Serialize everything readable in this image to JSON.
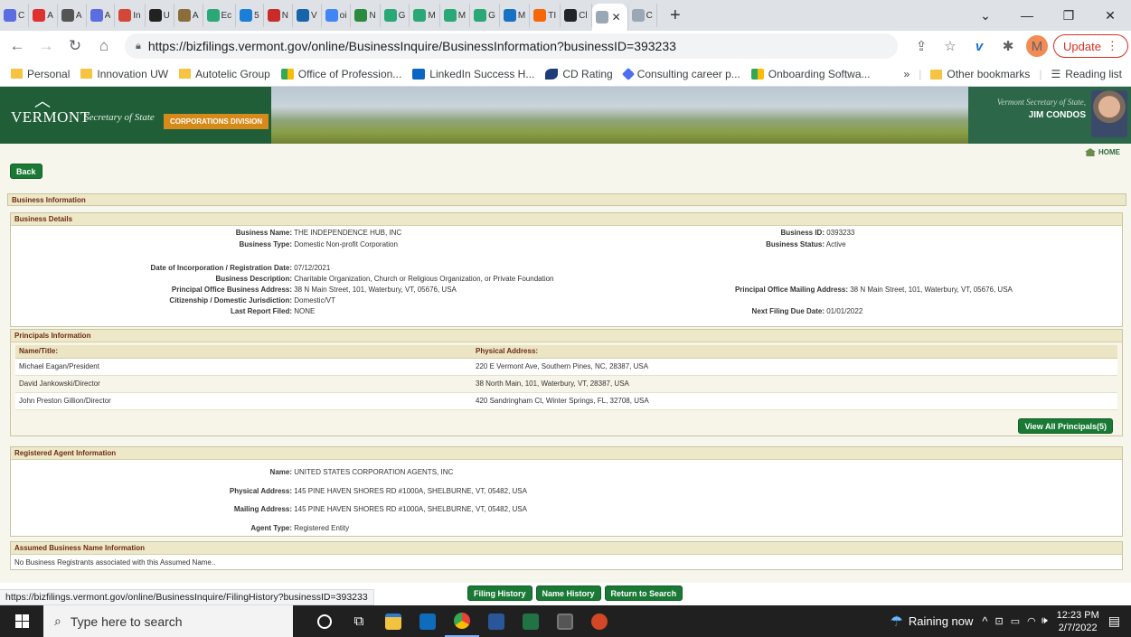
{
  "browser": {
    "tabs": [
      {
        "label": "C",
        "color": "#5b6ee1"
      },
      {
        "label": "A",
        "color": "#e03131"
      },
      {
        "label": "A",
        "color": "#555555"
      },
      {
        "label": "A",
        "color": "#5b6ee1"
      },
      {
        "label": "In",
        "color": "#d44638"
      },
      {
        "label": "U",
        "color": "#222222"
      },
      {
        "label": "A",
        "color": "#8a6d3b"
      },
      {
        "label": "Ec",
        "color": "#2aa876"
      },
      {
        "label": "5",
        "color": "#1c7ed6"
      },
      {
        "label": "N",
        "color": "#c92a2a"
      },
      {
        "label": "V",
        "color": "#1864ab"
      },
      {
        "label": "oi",
        "color": "#4285f4"
      },
      {
        "label": "N",
        "color": "#2b8a3e"
      },
      {
        "label": "G",
        "color": "#2aa876"
      },
      {
        "label": "M",
        "color": "#2aa876"
      },
      {
        "label": "M",
        "color": "#2aa876"
      },
      {
        "label": "G",
        "color": "#2aa876"
      },
      {
        "label": "M",
        "color": "#1971c2"
      },
      {
        "label": "TI",
        "color": "#f76707"
      },
      {
        "label": "Cl",
        "color": "#212529"
      }
    ],
    "active_tab": {
      "label": "",
      "color": "#9aa7b4"
    },
    "extra_tab": {
      "label": "C",
      "color": "#9aa7b4"
    },
    "url": "https://bizfilings.vermont.gov/online/BusinessInquire/BusinessInformation?businessID=393233",
    "profile_initial": "M",
    "update_label": "Update",
    "bookmarks": [
      "Personal",
      "Innovation UW",
      "Autotelic Group",
      "Office of Profession...",
      "LinkedIn Success H...",
      "CD Rating",
      "Consulting career p...",
      "Onboarding Softwa..."
    ],
    "bookmarks_more": "»",
    "other_bookmarks": "Other bookmarks",
    "reading_list": "Reading list"
  },
  "banner": {
    "logo": "VERMONT",
    "secretary": "Secretary of State",
    "division": "CORPORATIONS DIVISION",
    "official_title": "Vermont Secretary of State,",
    "official_name": "JIM CONDOS"
  },
  "page": {
    "home_label": "HOME",
    "back_label": "Back",
    "business_info_header": "Business Information",
    "business_details_header": "Business Details",
    "details": {
      "business_name_label": "Business Name:",
      "business_name": "THE INDEPENDENCE HUB, INC",
      "business_type_label": "Business Type:",
      "business_type": "Domestic Non-profit Corporation",
      "business_id_label": "Business ID:",
      "business_id": "0393233",
      "business_status_label": "Business Status:",
      "business_status": "Active",
      "incorporation_label": "Date of Incorporation / Registration Date:",
      "incorporation": "07/12/2021",
      "description_label": "Business Description:",
      "description": "Charitable Organization, Church or Religious Organization, or Private Foundation",
      "principal_address_label": "Principal Office Business Address:",
      "principal_address": "38 N Main Street, 101, Waterbury, VT, 05676, USA",
      "mailing_address_label": "Principal Office Mailing Address:",
      "mailing_address": "38 N Main Street, 101, Waterbury, VT, 05676, USA",
      "citizenship_label": "Citizenship / Domestic Jurisdiction:",
      "citizenship": "Domestic/VT",
      "last_report_label": "Last Report Filed:",
      "last_report": "NONE",
      "next_due_label": "Next Filing Due Date:",
      "next_due": "01/01/2022"
    },
    "principals": {
      "header": "Principals Information",
      "col_name": "Name/Title:",
      "col_address": "Physical Address:",
      "rows": [
        {
          "name": "Michael Eagan/President",
          "address": "220 E Vermont Ave, Southern Pines, NC, 28387, USA"
        },
        {
          "name": "David Jankowski/Director",
          "address": "38 North Main, 101, Waterbury, VT, 28387, USA"
        },
        {
          "name": "John Preston Gillion/Director",
          "address": "420 Sandringham Ct, Winter Springs, FL, 32708, USA"
        }
      ],
      "view_all_label": "View All Principals(5)"
    },
    "agent": {
      "header": "Registered Agent Information",
      "name_label": "Name:",
      "name": "UNITED STATES CORPORATION AGENTS, INC",
      "physical_label": "Physical Address:",
      "physical": "145 PINE HAVEN SHORES RD #1000A, SHELBURNE, VT, 05482, USA",
      "mailing_label": "Mailing Address:",
      "mailing": "145 PINE HAVEN SHORES RD #1000A, SHELBURNE, VT, 05482, USA",
      "type_label": "Agent Type:",
      "type": "Registered Entity"
    },
    "assumed": {
      "header": "Assumed Business Name Information",
      "text": "No Business Registrants associated with this Assumed Name.."
    },
    "buttons": {
      "filing_history": "Filing History",
      "name_history": "Name History",
      "return_search": "Return to Search"
    },
    "status_url": "https://bizfilings.vermont.gov/online/BusinessInquire/FilingHistory?businessID=393233"
  },
  "taskbar": {
    "search_placeholder": "Type here to search",
    "weather": "Raining now",
    "time": "12:23 PM",
    "date": "2/7/2022"
  }
}
